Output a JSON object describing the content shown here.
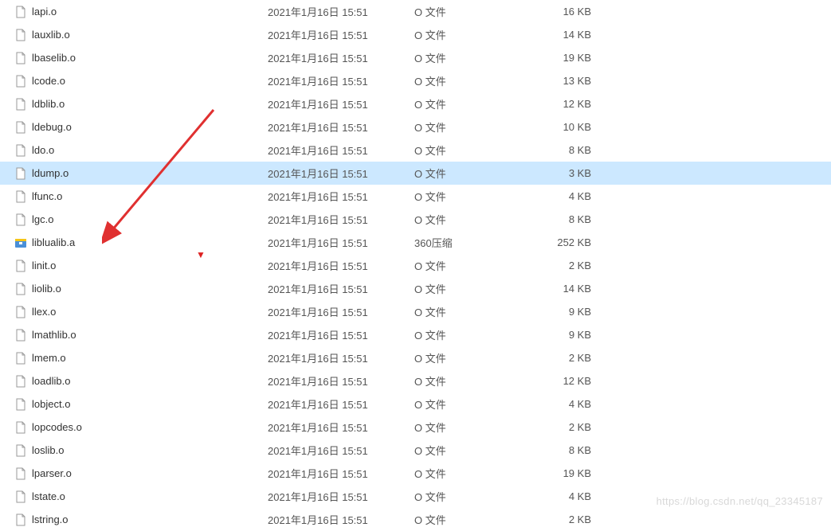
{
  "files": [
    {
      "name": "lapi.o",
      "date": "2021年1月16日 15:51",
      "type": "O 文件",
      "size": "16 KB",
      "icon": "file"
    },
    {
      "name": "lauxlib.o",
      "date": "2021年1月16日 15:51",
      "type": "O 文件",
      "size": "14 KB",
      "icon": "file"
    },
    {
      "name": "lbaselib.o",
      "date": "2021年1月16日 15:51",
      "type": "O 文件",
      "size": "19 KB",
      "icon": "file"
    },
    {
      "name": "lcode.o",
      "date": "2021年1月16日 15:51",
      "type": "O 文件",
      "size": "13 KB",
      "icon": "file"
    },
    {
      "name": "ldblib.o",
      "date": "2021年1月16日 15:51",
      "type": "O 文件",
      "size": "12 KB",
      "icon": "file"
    },
    {
      "name": "ldebug.o",
      "date": "2021年1月16日 15:51",
      "type": "O 文件",
      "size": "10 KB",
      "icon": "file"
    },
    {
      "name": "ldo.o",
      "date": "2021年1月16日 15:51",
      "type": "O 文件",
      "size": "8 KB",
      "icon": "file"
    },
    {
      "name": "ldump.o",
      "date": "2021年1月16日 15:51",
      "type": "O 文件",
      "size": "3 KB",
      "icon": "file",
      "selected": true
    },
    {
      "name": "lfunc.o",
      "date": "2021年1月16日 15:51",
      "type": "O 文件",
      "size": "4 KB",
      "icon": "file"
    },
    {
      "name": "lgc.o",
      "date": "2021年1月16日 15:51",
      "type": "O 文件",
      "size": "8 KB",
      "icon": "file"
    },
    {
      "name": "liblualib.a",
      "date": "2021年1月16日 15:51",
      "type": "360压缩",
      "size": "252 KB",
      "icon": "archive"
    },
    {
      "name": "linit.o",
      "date": "2021年1月16日 15:51",
      "type": "O 文件",
      "size": "2 KB",
      "icon": "file"
    },
    {
      "name": "liolib.o",
      "date": "2021年1月16日 15:51",
      "type": "O 文件",
      "size": "14 KB",
      "icon": "file"
    },
    {
      "name": "llex.o",
      "date": "2021年1月16日 15:51",
      "type": "O 文件",
      "size": "9 KB",
      "icon": "file"
    },
    {
      "name": "lmathlib.o",
      "date": "2021年1月16日 15:51",
      "type": "O 文件",
      "size": "9 KB",
      "icon": "file"
    },
    {
      "name": "lmem.o",
      "date": "2021年1月16日 15:51",
      "type": "O 文件",
      "size": "2 KB",
      "icon": "file"
    },
    {
      "name": "loadlib.o",
      "date": "2021年1月16日 15:51",
      "type": "O 文件",
      "size": "12 KB",
      "icon": "file"
    },
    {
      "name": "lobject.o",
      "date": "2021年1月16日 15:51",
      "type": "O 文件",
      "size": "4 KB",
      "icon": "file"
    },
    {
      "name": "lopcodes.o",
      "date": "2021年1月16日 15:51",
      "type": "O 文件",
      "size": "2 KB",
      "icon": "file"
    },
    {
      "name": "loslib.o",
      "date": "2021年1月16日 15:51",
      "type": "O 文件",
      "size": "8 KB",
      "icon": "file"
    },
    {
      "name": "lparser.o",
      "date": "2021年1月16日 15:51",
      "type": "O 文件",
      "size": "19 KB",
      "icon": "file"
    },
    {
      "name": "lstate.o",
      "date": "2021年1月16日 15:51",
      "type": "O 文件",
      "size": "4 KB",
      "icon": "file"
    },
    {
      "name": "lstring.o",
      "date": "2021年1月16日 15:51",
      "type": "O 文件",
      "size": "2 KB",
      "icon": "file"
    }
  ],
  "watermark": "https://blog.csdn.net/qq_23345187",
  "icons": {
    "file": "generic-file-icon",
    "archive": "archive-icon"
  }
}
